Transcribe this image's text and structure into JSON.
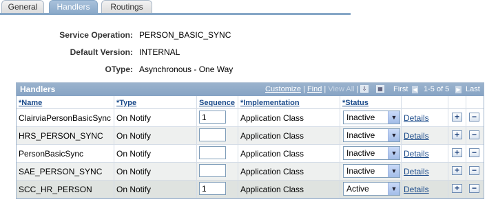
{
  "tabs": [
    {
      "label": "General",
      "active": false
    },
    {
      "label": "Handlers",
      "active": true
    },
    {
      "label": "Routings",
      "active": false
    }
  ],
  "info": {
    "service_operation_label": "Service Operation:",
    "service_operation_value": "PERSON_BASIC_SYNC",
    "default_version_label": "Default Version:",
    "default_version_value": "INTERNAL",
    "otype_label": "OType:",
    "otype_value": "Asynchronous - One Way"
  },
  "grid": {
    "title": "Handlers",
    "nav": {
      "customize": "Customize",
      "sep1": "|",
      "find": "Find",
      "sep2": "|",
      "view_all": "View All",
      "sep3": "|",
      "first": "First",
      "count": "1-5 of 5",
      "last": "Last"
    },
    "columns": {
      "name": "*Name",
      "type": "*Type",
      "sequence": "Sequence",
      "implementation": "*Implementation",
      "status": "*Status"
    },
    "rows": [
      {
        "name": "ClairviaPersonBasicSync",
        "type": "On Notify",
        "sequence": "1",
        "implementation": "Application Class",
        "status": "Inactive",
        "details": "Details"
      },
      {
        "name": "HRS_PERSON_SYNC",
        "type": "On Notify",
        "sequence": "",
        "implementation": "Application Class",
        "status": "Inactive",
        "details": "Details"
      },
      {
        "name": "PersonBasicSync",
        "type": "On Notify",
        "sequence": "",
        "implementation": "Application Class",
        "status": "Inactive",
        "details": "Details"
      },
      {
        "name": "SAE_PERSON_SYNC",
        "type": "On Notify",
        "sequence": "",
        "implementation": "Application Class",
        "status": "Inactive",
        "details": "Details"
      },
      {
        "name": "SCC_HR_PERSON",
        "type": "On Notify",
        "sequence": "1",
        "implementation": "Application Class",
        "status": "Active",
        "details": "Details"
      }
    ],
    "add_symbol": "+",
    "remove_symbol": "−"
  }
}
